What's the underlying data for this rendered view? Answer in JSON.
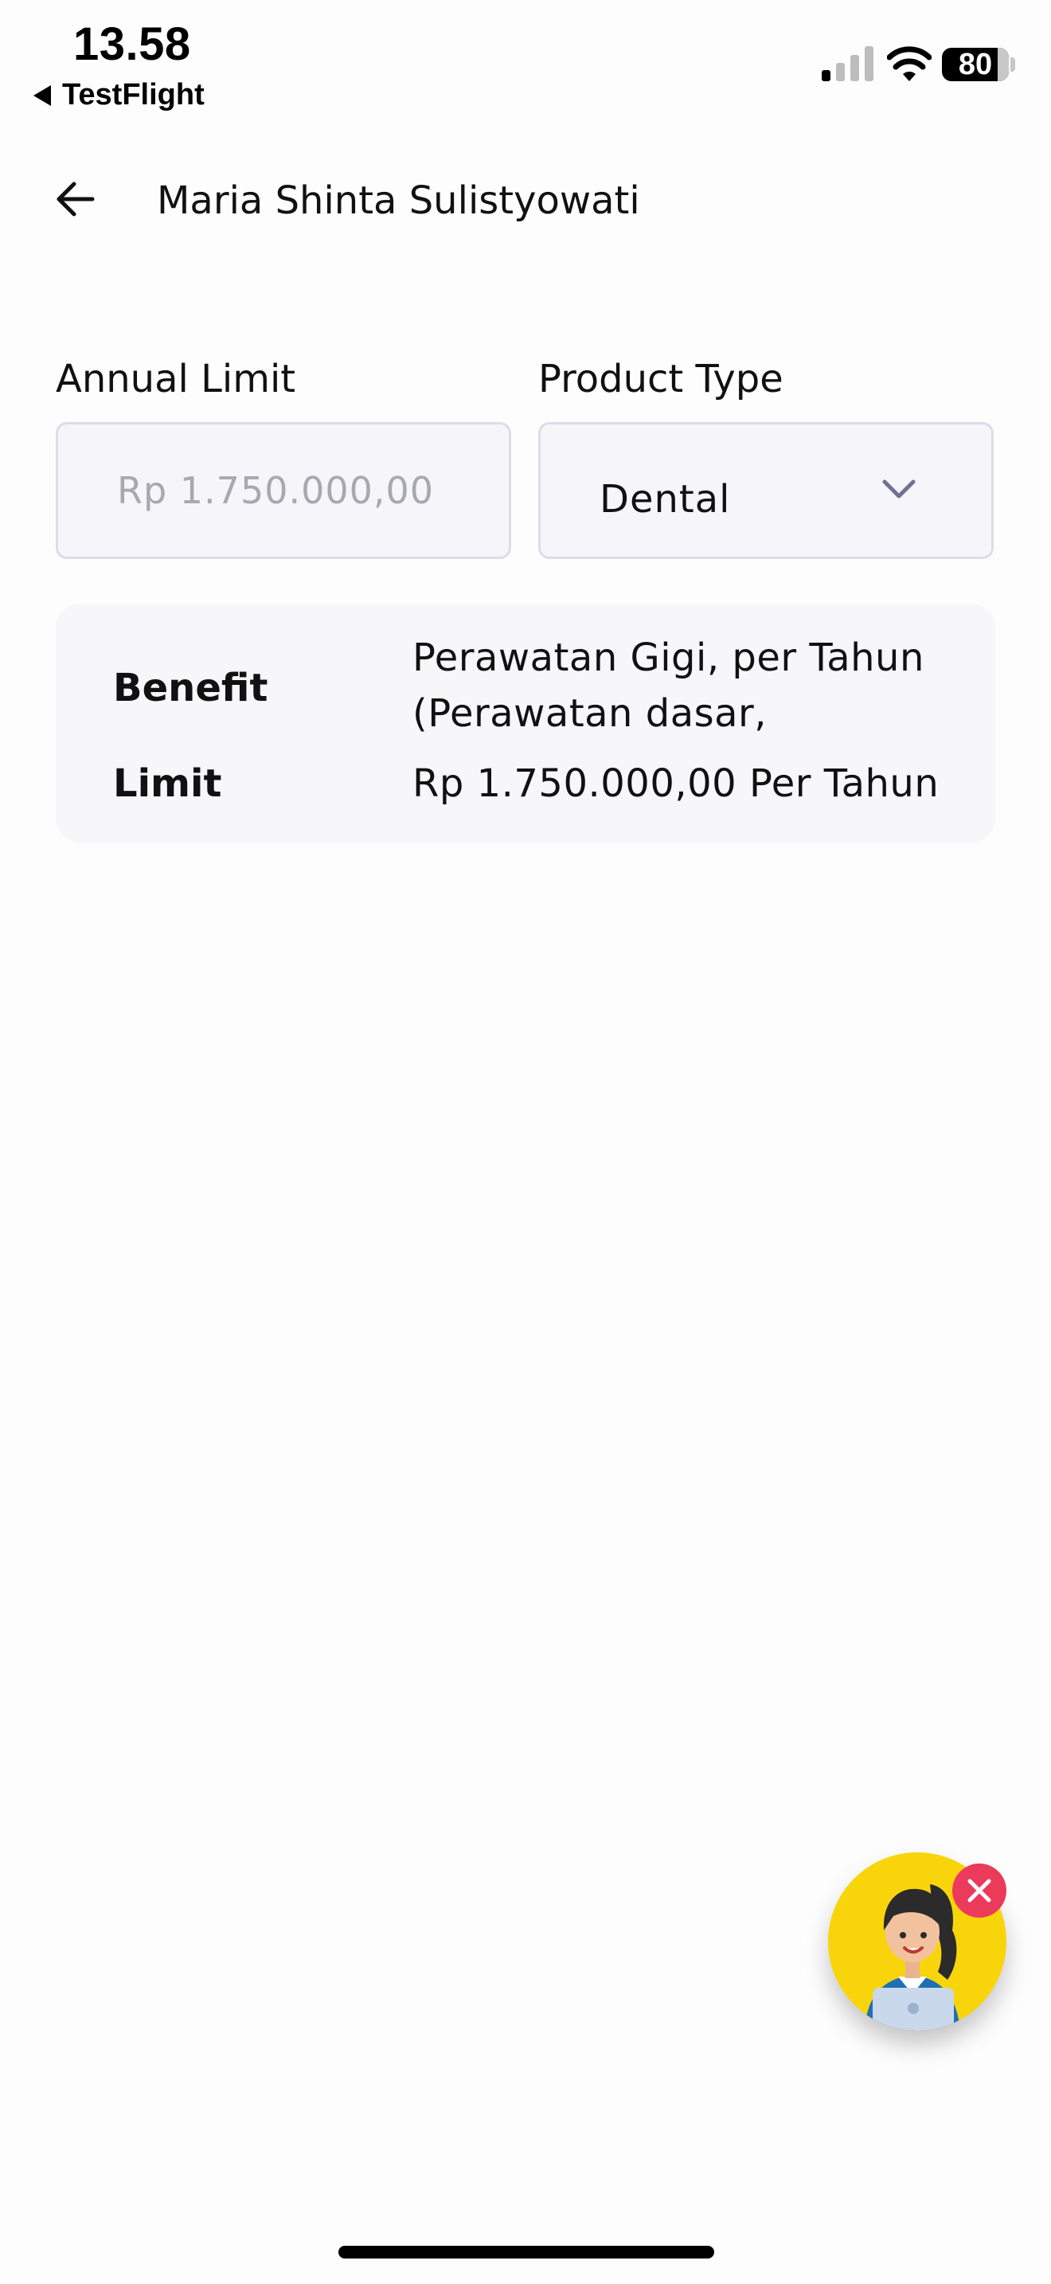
{
  "status_bar": {
    "time": "13.58",
    "back_app": "TestFlight",
    "battery": "80",
    "icons": [
      "signal-icon",
      "wifi-icon",
      "battery-icon"
    ]
  },
  "header": {
    "title": "Maria Shinta Sulistyowati",
    "back_icon": "arrow-left-icon"
  },
  "form": {
    "annual_limit": {
      "label": "Annual Limit",
      "value": "Rp 1.750.000,00"
    },
    "product_type": {
      "label": "Product Type",
      "selected": "Dental",
      "icon": "chevron-down-icon"
    }
  },
  "benefit_card": {
    "benefit_label": "Benefit",
    "benefit_line1": "Perawatan Gigi, per Tahun",
    "benefit_line2": "(Perawatan dasar,",
    "limit_label": "Limit",
    "limit_value": "Rp 1.750.000,00 Per Tahun"
  },
  "assistant": {
    "icon": "assistant-avatar-icon",
    "close_icon": "close-icon",
    "colors": {
      "background": "#f8d50b",
      "close": "#ec3a5a"
    }
  }
}
